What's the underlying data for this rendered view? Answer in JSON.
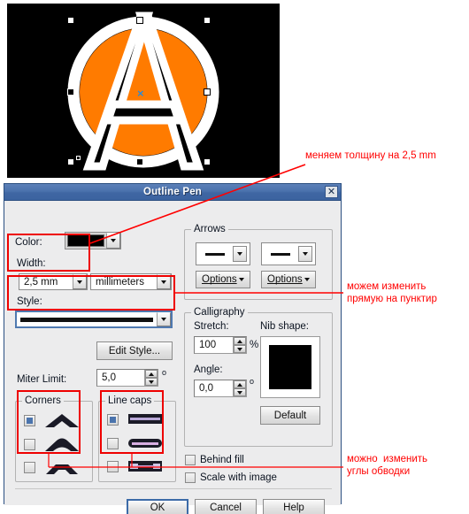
{
  "artwork": {
    "name": "anarchy-circle-a-logo",
    "background_color": "#000000",
    "symbol_fill_color": "#ff7b00",
    "outline_color": "#ffffff",
    "center_marker": "×"
  },
  "dialog": {
    "title": "Outline Pen",
    "close_label": "✕",
    "color": {
      "label": "Color:",
      "swatch_color": "#000000"
    },
    "width": {
      "label": "Width:",
      "value": "2,5 mm",
      "units_value": "millimeters"
    },
    "style": {
      "label": "Style:",
      "value": "solid-line",
      "edit_button": "Edit Style..."
    },
    "miter_limit": {
      "label": "Miter Limit:",
      "value": "5,0",
      "suffix": "o"
    },
    "arrows": {
      "title": "Arrows",
      "start_preview": "plain-line",
      "end_preview": "plain-line",
      "options_start": "Options",
      "options_end": "Options"
    },
    "calligraphy": {
      "title": "Calligraphy",
      "stretch_label": "Stretch:",
      "stretch_value": "100",
      "stretch_suffix": "%",
      "angle_label": "Angle:",
      "angle_value": "0,0",
      "angle_suffix": "o",
      "nib_label": "Nib shape:",
      "nib_color": "#000000",
      "default_button": "Default"
    },
    "corners": {
      "title": "Corners",
      "options": [
        "miter-corner",
        "round-corner",
        "bevel-corner"
      ],
      "selected_index": 0
    },
    "line_caps": {
      "title": "Line caps",
      "options": [
        "butt-cap",
        "round-cap",
        "square-cap"
      ],
      "selected_index": 0
    },
    "checkboxes": [
      {
        "label": "Behind fill",
        "checked": false
      },
      {
        "label": "Scale with image",
        "checked": false
      }
    ],
    "buttons": {
      "ok": "OK",
      "cancel": "Cancel",
      "help": "Help"
    }
  },
  "annotations": {
    "accent_color": "#ff0000",
    "notes": [
      {
        "text": "меняем толщину на 2,5 mm",
        "target": "width-field"
      },
      {
        "text": "можем изменить\nпрямую на пунктир",
        "target": "style-field"
      },
      {
        "text": "можно  изменить\nуглы обводки",
        "target": "corners-and-line-caps"
      }
    ]
  }
}
